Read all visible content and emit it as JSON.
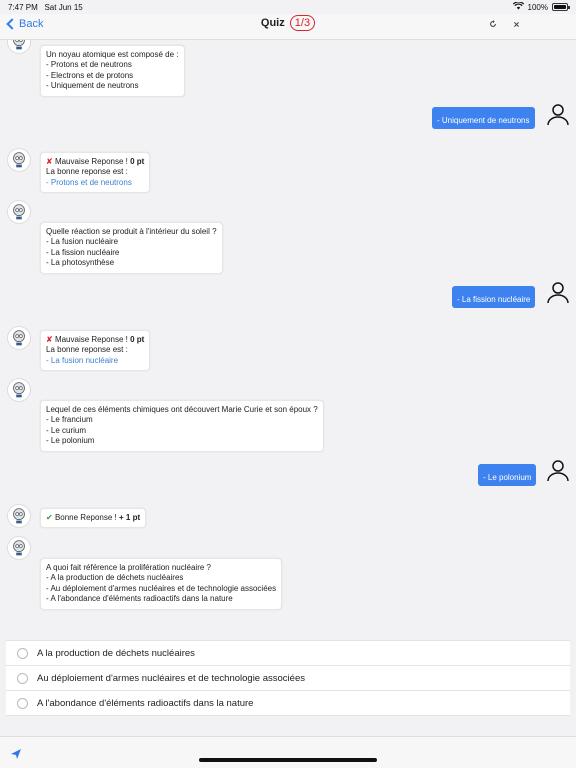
{
  "status": {
    "time": "7:47 PM",
    "date": "Sat Jun 15",
    "battery": "100%"
  },
  "nav": {
    "back_label": "Back",
    "title": "Quiz",
    "progress": "1/3",
    "refresh_icon": "refresh-icon",
    "close_icon": "close-icon"
  },
  "chat": {
    "q1": {
      "title": "Un noyau atomique est composé de :",
      "opts": [
        "- Protons et de neutrons",
        "- Electrons et de protons",
        "- Uniquement de neutrons"
      ]
    },
    "a1": "- Uniquement de neutrons",
    "r1": {
      "verdict": "Mauvaise Reponse !",
      "points": "0 pt",
      "label": "La bonne reponse est :",
      "answer": "- Protons et de neutrons"
    },
    "q2": {
      "title": "Quelle réaction se produit à l'intérieur du soleil ?",
      "opts": [
        "- La fusion nucléaire",
        "- La fission nucléaire",
        "- La photosynthèse"
      ]
    },
    "a2": "- La fission nucléaire",
    "r2": {
      "verdict": "Mauvaise Reponse !",
      "points": "0 pt",
      "label": "La bonne reponse est :",
      "answer": "- La fusion nucléaire"
    },
    "q3": {
      "title": "Lequel de ces éléments chimiques ont découvert Marie Curie et son époux ?",
      "opts": [
        "- Le francium",
        "- Le curium",
        "- Le polonium"
      ]
    },
    "a3": "- Le polonium",
    "r3": {
      "verdict": "Bonne Reponse !",
      "points": "+ 1 pt"
    },
    "q4": {
      "title": "A quoi fait référence la prolifération nucléaire ?",
      "opts": [
        "- A la production de déchets nucléaires",
        "- Au déploiement d'armes nucléaires et de technologie associées",
        "- A l'abondance d'éléments radioactifs dans la nature"
      ]
    }
  },
  "choices": [
    "A la production de déchets nucléaires",
    "Au déploiement d'armes nucléaires et de technologie associées",
    "A l'abondance d'éléments radioactifs dans la nature"
  ],
  "colors": {
    "accent": "#3d82ee",
    "wrong": "#d6232e",
    "right": "#2a9d3a"
  }
}
